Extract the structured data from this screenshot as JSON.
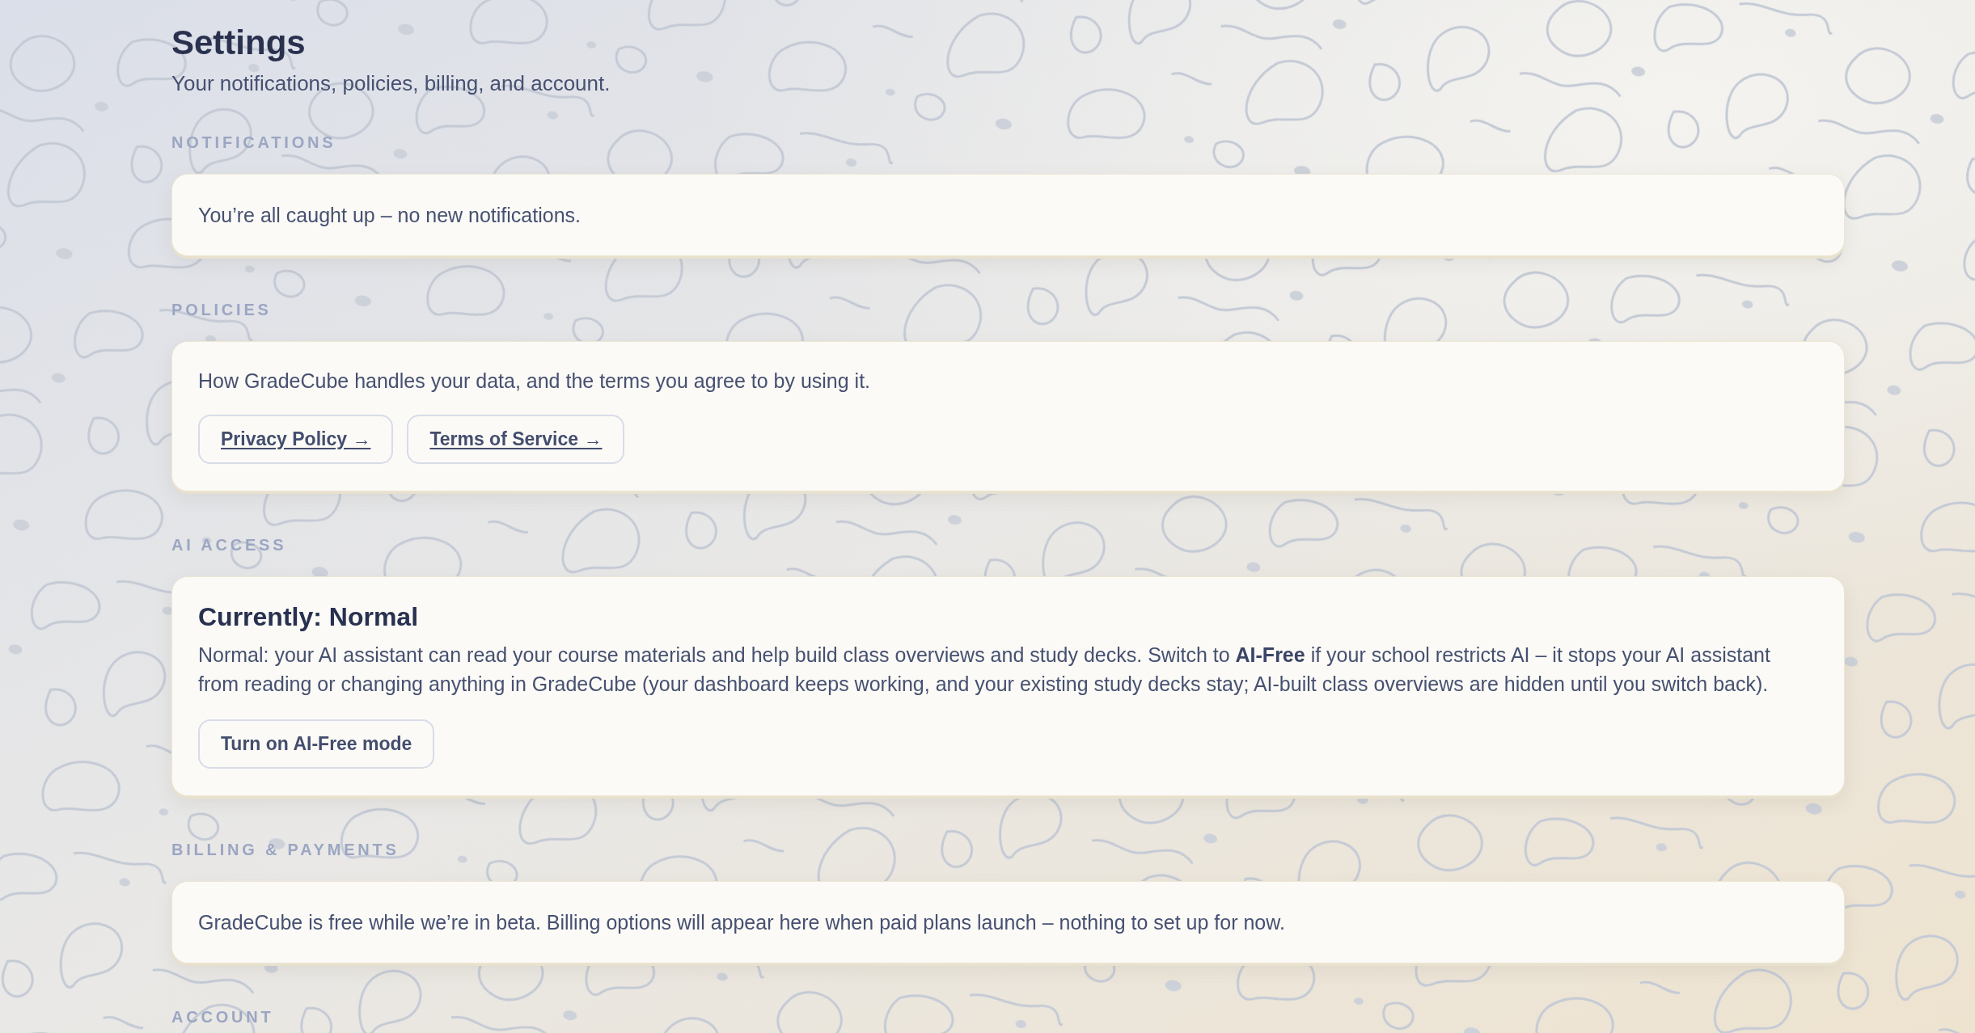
{
  "page": {
    "title": "Settings",
    "subtitle": "Your notifications, policies, billing, and account."
  },
  "sections": [
    {
      "kind": "message",
      "heading": "NOTIFICATIONS",
      "text": "You’re all caught up – no new notifications."
    },
    {
      "kind": "links",
      "heading": "POLICIES",
      "text": "How GradeCube handles your data, and the terms you agree to by using it.",
      "links": [
        "Privacy Policy →",
        "Terms of Service →"
      ]
    },
    {
      "kind": "mode",
      "heading": "AI ACCESS",
      "status": "Currently: Normal",
      "text": "Normal: your AI assistant can read your course materials and help build class overviews and study decks. Switch to **AI-Free** if your school restricts AI – it stops your AI assistant from reading or changing anything in GradeCube (your dashboard keeps working, and your existing study decks stay; AI-built class overviews are hidden until you switch back).",
      "button": "Turn on AI-Free mode"
    },
    {
      "kind": "message",
      "heading": "BILLING & PAYMENTS",
      "text": "GradeCube is free while we’re in beta. Billing options will appear here when paid plans launch – nothing to set up for now."
    },
    {
      "kind": "heading_only",
      "heading": "ACCOUNT"
    }
  ]
}
